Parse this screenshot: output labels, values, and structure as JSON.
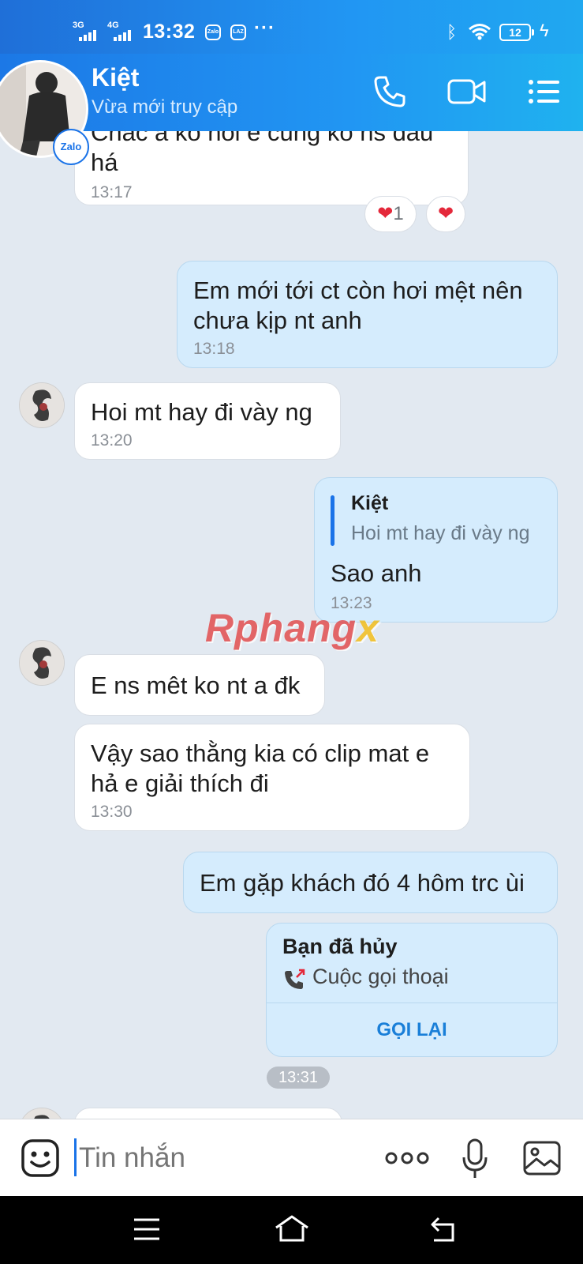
{
  "status_bar": {
    "net1": "3G",
    "net2": "4G",
    "time": "13:32",
    "app_badge_1": "Zalo",
    "app_badge_2": "LAZ",
    "more": "···",
    "battery": "12"
  },
  "header": {
    "contact_name": "Kiệt",
    "presence": "Vừa mới truy cập",
    "badge": "Zalo"
  },
  "messages": [
    {
      "side": "in",
      "text": "Chắc a ko nói e cũng ko ns đâu há",
      "time": "13:17",
      "reaction_count": "1"
    },
    {
      "side": "out",
      "text": "Em mới tới ct còn hơi mệt nên chưa kịp nt anh",
      "time": "13:18"
    },
    {
      "side": "in",
      "text": "Hoi mt hay đi vày ng",
      "time": "13:20"
    },
    {
      "side": "out",
      "quote_name": "Kiệt",
      "quote_text": "Hoi mt hay đi vày ng",
      "text": "Sao anh",
      "time": "13:23"
    },
    {
      "side": "in",
      "text": "E ns mêt ko nt a đk"
    },
    {
      "side": "in",
      "text": "Vậy sao thằng kia có clip mat e hả e giải thích đi",
      "time": "13:30"
    },
    {
      "side": "out",
      "text": "Em gặp khách đó 4 hôm trc ùi"
    }
  ],
  "call_card": {
    "title": "Bạn đã hủy",
    "subtitle": "Cuộc gọi thoại",
    "action": "GỌI LẠI"
  },
  "time_separator": "13:31",
  "watermark": {
    "main": "Rphang",
    "accent": "x"
  },
  "input": {
    "placeholder": "Tin nhắn"
  },
  "colors": {
    "header": "#2196f3",
    "out_bubble": "#d5ecfd",
    "in_bubble": "#ffffff",
    "chat_bg": "#e2e9f1",
    "accent": "#1a73e8"
  }
}
